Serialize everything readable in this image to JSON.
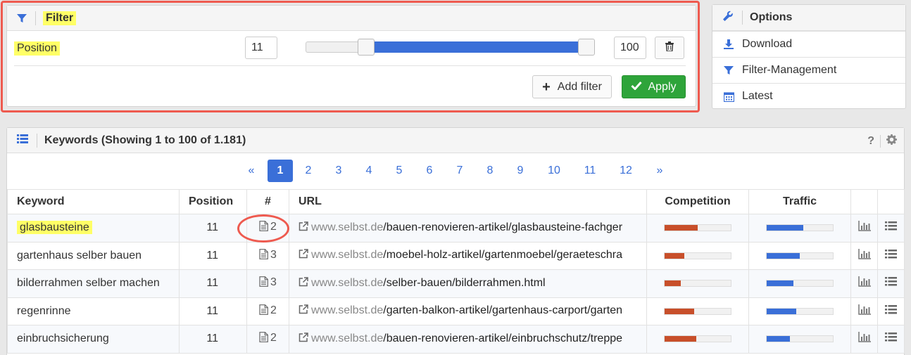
{
  "filter": {
    "title": "Filter",
    "field_label": "Position",
    "min_value": "11",
    "max_value": "100",
    "range": {
      "min": 0,
      "max": 100,
      "low": 11,
      "high": 100
    },
    "add_filter_label": "Add filter",
    "apply_label": "Apply"
  },
  "options": {
    "title": "Options",
    "items": [
      {
        "label": "Download",
        "icon": "download-icon"
      },
      {
        "label": "Filter-Management",
        "icon": "filter-icon"
      },
      {
        "label": "Latest",
        "icon": "calendar-icon"
      }
    ]
  },
  "keywords": {
    "title": "Keywords (Showing 1 to 100 of 1.181)",
    "help": "?",
    "pagination": {
      "prev": "«",
      "next": "»",
      "pages": [
        "1",
        "2",
        "3",
        "4",
        "5",
        "6",
        "7",
        "8",
        "9",
        "10",
        "11",
        "12"
      ],
      "active": "1"
    },
    "columns": {
      "keyword": "Keyword",
      "position": "Position",
      "hash": "#",
      "url": "URL",
      "competition": "Competition",
      "traffic": "Traffic"
    },
    "rows": [
      {
        "keyword": "glasbausteine",
        "position": "11",
        "count": "2",
        "domain": "www.selbst.de",
        "path": "/bauen-renovieren-artikel/glasbausteine-fachger",
        "competition": 0.5,
        "traffic": 0.55
      },
      {
        "keyword": "gartenhaus selber bauen",
        "position": "11",
        "count": "3",
        "domain": "www.selbst.de",
        "path": "/moebel-holz-artikel/gartenmoebel/geraeteschra",
        "competition": 0.3,
        "traffic": 0.5
      },
      {
        "keyword": "bilderrahmen selber machen",
        "position": "11",
        "count": "3",
        "domain": "www.selbst.de",
        "path": "/selber-bauen/bilderrahmen.html",
        "competition": 0.24,
        "traffic": 0.4
      },
      {
        "keyword": "regenrinne",
        "position": "11",
        "count": "2",
        "domain": "www.selbst.de",
        "path": "/garten-balkon-artikel/gartenhaus-carport/garten",
        "competition": 0.45,
        "traffic": 0.45
      },
      {
        "keyword": "einbruchsicherung",
        "position": "11",
        "count": "2",
        "domain": "www.selbst.de",
        "path": "/bauen-renovieren-artikel/einbruchschutz/treppe",
        "competition": 0.48,
        "traffic": 0.35
      }
    ]
  },
  "colors": {
    "accent": "#3a6fd8",
    "apply": "#2ea43a",
    "highlight": "#ffff66",
    "annotation": "#ee5a4f",
    "competition": "#c84f2a"
  }
}
